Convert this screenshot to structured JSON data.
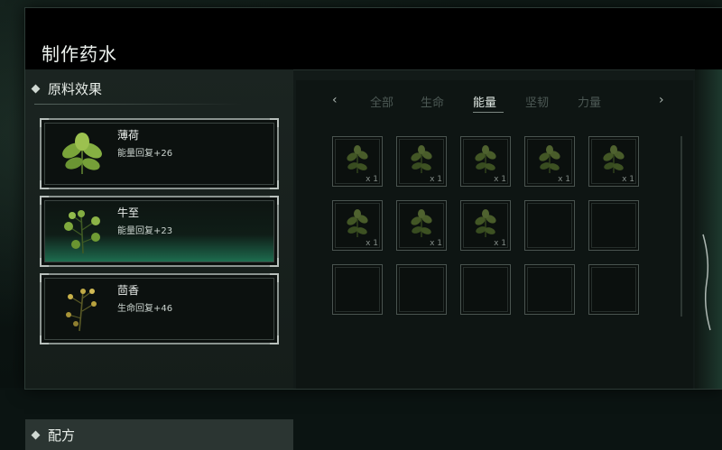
{
  "window": {
    "title": "制作药水"
  },
  "sections": {
    "effects": "原料效果",
    "recipe": "配方"
  },
  "ingredients": [
    {
      "name": "薄荷",
      "effect": "能量回复+26",
      "selected": false,
      "icon": "mint-leaf-icon"
    },
    {
      "name": "牛至",
      "effect": "能量回复+23",
      "selected": true,
      "icon": "oregano-sprig-icon"
    },
    {
      "name": "茴香",
      "effect": "生命回复+46",
      "selected": false,
      "icon": "fennel-sprig-icon"
    }
  ],
  "tabs": {
    "items": [
      "全部",
      "生命",
      "能量",
      "坚韧",
      "力量"
    ],
    "active_index": 2,
    "prev_arrow": "‹",
    "next_arrow": "›"
  },
  "inventory": {
    "slots": [
      {
        "qty": "x 1",
        "icon": "herb-icon"
      },
      {
        "qty": "x 1",
        "icon": "herb-icon"
      },
      {
        "qty": "x 1",
        "icon": "herb-icon"
      },
      {
        "qty": "x 1",
        "icon": "herb-icon"
      },
      {
        "qty": "x 1",
        "icon": "herb-icon"
      },
      {
        "qty": "x 1",
        "icon": "herb-icon"
      },
      {
        "qty": "x 1",
        "icon": "herb-icon"
      },
      {
        "qty": "x 1",
        "icon": "herb-icon"
      },
      {
        "qty": "",
        "icon": ""
      },
      {
        "qty": "",
        "icon": ""
      },
      {
        "qty": "",
        "icon": ""
      },
      {
        "qty": "",
        "icon": ""
      },
      {
        "qty": "",
        "icon": ""
      },
      {
        "qty": "",
        "icon": ""
      },
      {
        "qty": "",
        "icon": ""
      }
    ]
  },
  "colors": {
    "accent_green": "#1f7a57",
    "frame": "#8a938f",
    "background": "#0b1412"
  }
}
